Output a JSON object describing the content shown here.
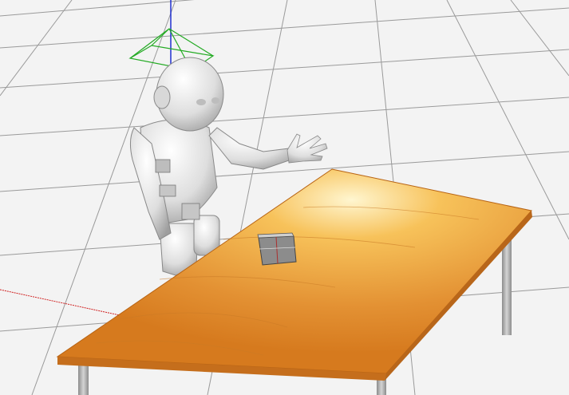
{
  "scene": {
    "subject": "robot-at-table",
    "floor_color": "#f3f3f3",
    "grid_color": "#9a9a9a",
    "table_color": "#e08a2a",
    "table_highlight": "#fff6d0",
    "leg_color": "#a9a9a9",
    "robot_color": "#e8e8e8",
    "box_color": "#8a8a8a",
    "axis_colors": {
      "x": "#d02020",
      "y": "#20a020",
      "z": "#2030d0"
    }
  }
}
